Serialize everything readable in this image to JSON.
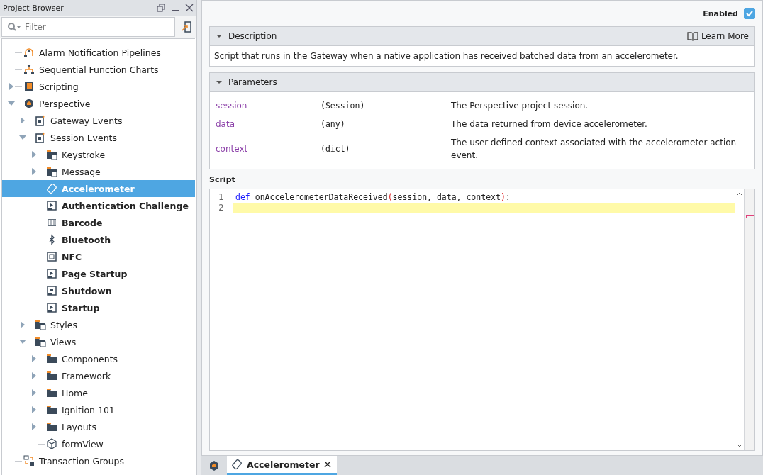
{
  "project_browser": {
    "title": "Project Browser",
    "filter": {
      "placeholder": "Filter"
    },
    "tree": [
      {
        "label": "Alarm Notification Pipelines",
        "kind": "pipeline",
        "selected": false,
        "configured": false
      },
      {
        "label": "Sequential Function Charts",
        "kind": "sfc",
        "selected": false,
        "configured": false
      },
      {
        "label": "Scripting",
        "kind": "scripting",
        "selected": false,
        "configured": false,
        "expanded": false
      },
      {
        "label": "Perspective",
        "kind": "project",
        "selected": false,
        "configured": false,
        "expanded": true,
        "children": [
          {
            "label": "Gateway Events",
            "kind": "events",
            "selected": false,
            "configured": false,
            "expanded": false
          },
          {
            "label": "Session Events",
            "kind": "events",
            "selected": false,
            "configured": false,
            "expanded": true,
            "children": [
              {
                "label": "Keystroke",
                "kind": "eventfolder",
                "selected": false,
                "configured": false,
                "expanded": false
              },
              {
                "label": "Message",
                "kind": "eventfolder",
                "selected": false,
                "configured": false,
                "expanded": false
              },
              {
                "label": "Accelerometer",
                "kind": "accel",
                "selected": true,
                "configured": true
              },
              {
                "label": "Authentication Challenge",
                "kind": "script",
                "selected": false,
                "configured": true
              },
              {
                "label": "Barcode",
                "kind": "barcode",
                "selected": false,
                "configured": true
              },
              {
                "label": "Bluetooth",
                "kind": "bluetooth",
                "selected": false,
                "configured": true
              },
              {
                "label": "NFC",
                "kind": "nfc",
                "selected": false,
                "configured": true
              },
              {
                "label": "Page Startup",
                "kind": "script",
                "selected": false,
                "configured": true
              },
              {
                "label": "Shutdown",
                "kind": "stop",
                "selected": false,
                "configured": true
              },
              {
                "label": "Startup",
                "kind": "script",
                "selected": false,
                "configured": true
              }
            ]
          },
          {
            "label": "Styles",
            "kind": "stylefolder",
            "selected": false,
            "configured": false,
            "expanded": false
          },
          {
            "label": "Views",
            "kind": "viewfolder",
            "selected": false,
            "configured": false,
            "expanded": true,
            "children": [
              {
                "label": "Components",
                "kind": "folder",
                "selected": false,
                "configured": false,
                "expanded": false
              },
              {
                "label": "Framework",
                "kind": "folder",
                "selected": false,
                "configured": false,
                "expanded": false
              },
              {
                "label": "Home",
                "kind": "folder",
                "selected": false,
                "configured": false,
                "expanded": false
              },
              {
                "label": "Ignition 101",
                "kind": "folder",
                "selected": false,
                "configured": false,
                "expanded": false
              },
              {
                "label": "Layouts",
                "kind": "folder",
                "selected": false,
                "configured": false,
                "expanded": false
              },
              {
                "label": "formView",
                "kind": "view",
                "selected": false,
                "configured": false
              }
            ]
          }
        ]
      },
      {
        "label": "Transaction Groups",
        "kind": "transaction",
        "selected": false,
        "configured": false
      }
    ]
  },
  "editor": {
    "enabled": {
      "label": "Enabled",
      "checked": true
    },
    "description": {
      "title": "Description",
      "expanded": true,
      "learn_more": "Learn More",
      "text": "Script that runs in the Gateway when a native application has received batched data from an accelerometer."
    },
    "parameters": {
      "title": "Parameters",
      "expanded": true,
      "rows": [
        {
          "name": "session",
          "type": "(Session)",
          "description": "The Perspective project session."
        },
        {
          "name": "data",
          "type": "(any)",
          "description": "The data returned from device accelerometer."
        },
        {
          "name": "context",
          "type": "(dict)",
          "description": "The user-defined context associated with the accelerometer action event."
        }
      ]
    },
    "script": {
      "label": "Script",
      "lines": [
        {
          "number": "1",
          "current": false,
          "tokens": [
            {
              "text": "def",
              "kind": "keyword"
            },
            {
              "text": " onAccelerometerDataReceived",
              "kind": "plain"
            },
            {
              "text": "(",
              "kind": "paren"
            },
            {
              "text": "session, data, context",
              "kind": "plain"
            },
            {
              "text": ")",
              "kind": "paren"
            },
            {
              "text": ":",
              "kind": "plain"
            }
          ]
        },
        {
          "number": "2",
          "current": true
        }
      ]
    }
  },
  "tabs": [
    {
      "label": "Accelerometer",
      "selected": true
    }
  ]
}
